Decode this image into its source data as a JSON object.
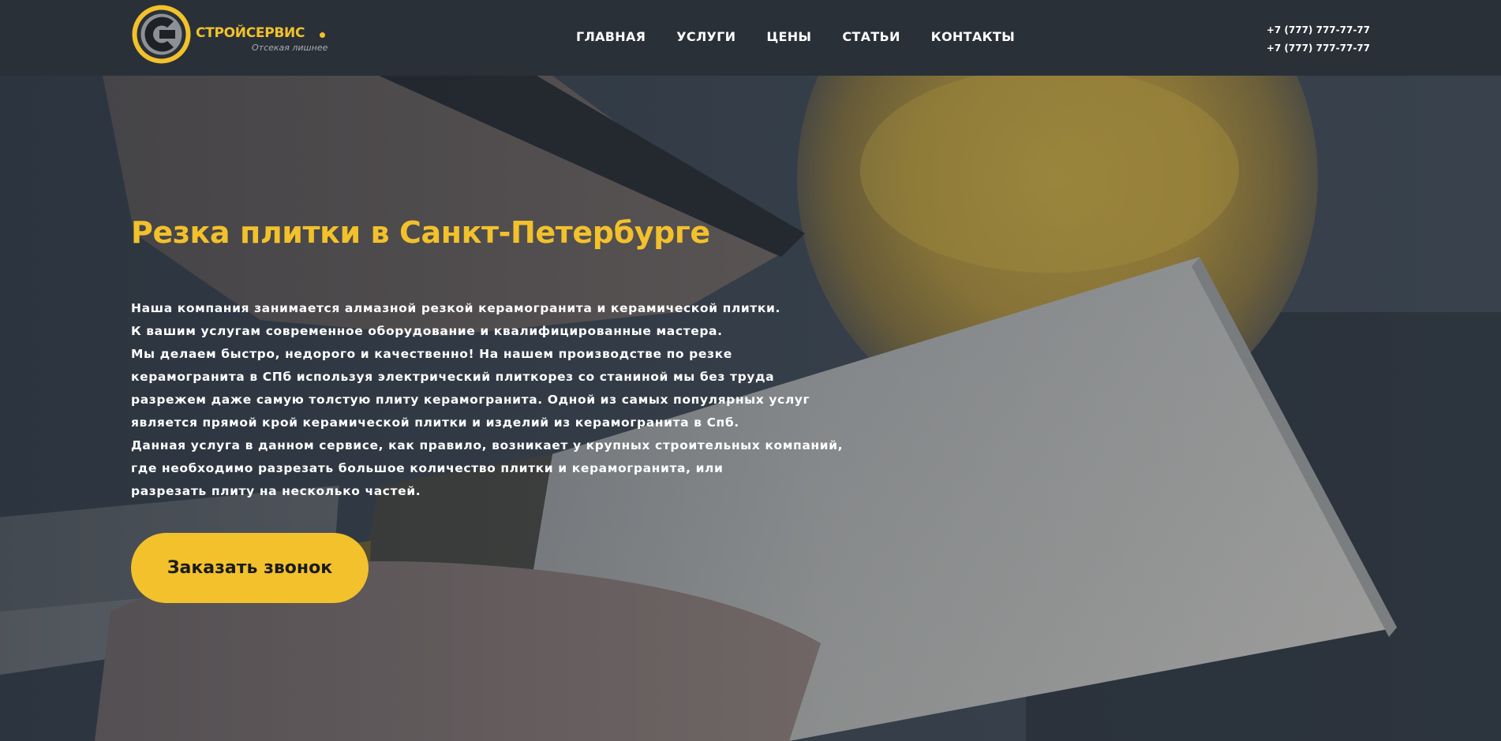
{
  "brand": {
    "name": "СТРОЙСЕРВИС",
    "tagline": "Отсекая лишнее",
    "colors": {
      "accent": "#f2c12b",
      "header_bg": "#293038",
      "text": "#ffffff"
    }
  },
  "nav": {
    "items": [
      {
        "label": "ГЛАВНАЯ"
      },
      {
        "label": "УСЛУГИ"
      },
      {
        "label": "ЦЕНЫ"
      },
      {
        "label": "СТАТЬИ"
      },
      {
        "label": "КОНТАКТЫ"
      }
    ]
  },
  "contacts": {
    "phones": [
      "+7 (777) 777-77-77",
      "+7 (777) 777-77-77"
    ]
  },
  "hero": {
    "title": "Резка плитки в Санкт-Петербурге",
    "lines": [
      "Наша компания занимается алмазной резкой керамогранита и керамической плитки.",
      "К вашим услугам современное оборудование и квалифицированные мастера.",
      "Мы делаем быстро, недорого и качественно! На нашем производстве по резке",
      "керамогранита в СПб используя электрический плиткорез со станиной мы без труда",
      "разрежем даже самую толстую плиту керамогранита. Одной из самых популярных услуг",
      "является прямой крой керамической плитки и изделий из керамогранита в Спб.",
      "Данная услуга в данном сервисе, как правило, возникает у крупных строительных компаний,",
      "где необходимо разрезать большое количество плитки и керамогранита, или",
      "разрезать плиту на несколько частей."
    ],
    "cta_label": "Заказать звонок",
    "background_icon": "tile-cutting-photo"
  }
}
